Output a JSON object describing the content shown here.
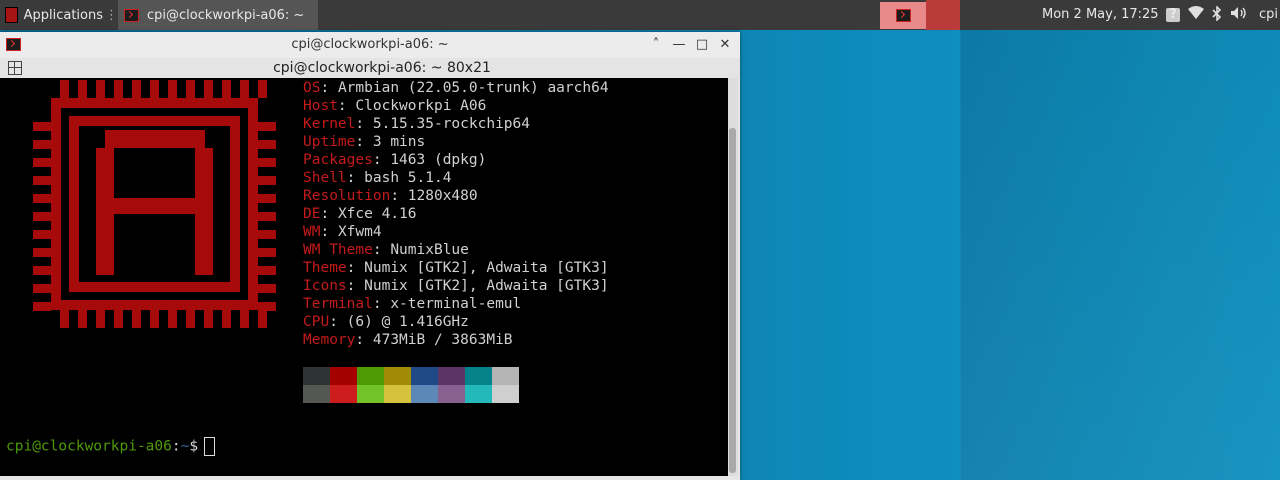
{
  "panel": {
    "applications_label": "Applications",
    "task_title": "cpi@clockworkpi-a06: ~",
    "clock": "Mon  2 May, 17:25",
    "user": "cpi"
  },
  "window": {
    "title": "cpi@clockworkpi-a06: ~",
    "tab_title": "cpi@clockworkpi-a06: ~ 80x21",
    "controls": {
      "up": "˄",
      "minimize": "—",
      "maximize": "□",
      "close": "✕"
    }
  },
  "sysinfo": [
    {
      "key": "OS",
      "value": "Armbian (22.05.0-trunk) aarch64"
    },
    {
      "key": "Host",
      "value": "Clockworkpi A06"
    },
    {
      "key": "Kernel",
      "value": "5.15.35-rockchip64"
    },
    {
      "key": "Uptime",
      "value": "3 mins"
    },
    {
      "key": "Packages",
      "value": "1463 (dpkg)"
    },
    {
      "key": "Shell",
      "value": "bash 5.1.4"
    },
    {
      "key": "Resolution",
      "value": "1280x480"
    },
    {
      "key": "DE",
      "value": "Xfce 4.16"
    },
    {
      "key": "WM",
      "value": "Xfwm4"
    },
    {
      "key": "WM Theme",
      "value": "NumixBlue"
    },
    {
      "key": "Theme",
      "value": "Numix [GTK2], Adwaita [GTK3]"
    },
    {
      "key": "Icons",
      "value": "Numix [GTK2], Adwaita [GTK3]"
    },
    {
      "key": "Terminal",
      "value": "x-terminal-emul"
    },
    {
      "key": "CPU",
      "value": "(6) @ 1.416GHz"
    },
    {
      "key": "Memory",
      "value": "473MiB / 3863MiB"
    }
  ],
  "palette": {
    "row1": [
      "#2e3436",
      "#a40000",
      "#4e9a06",
      "#a18a06",
      "#204a87",
      "#5c3566",
      "#06828a",
      "#b4b4b4"
    ],
    "row2": [
      "#555753",
      "#cc1c1c",
      "#73c22a",
      "#d6c23c",
      "#5c88b8",
      "#8a6090",
      "#24b8bb",
      "#cfcfcf"
    ]
  },
  "prompt": {
    "user_host": "cpi@clockworkpi-a06",
    "sep": ":",
    "path": "~",
    "symbol": "$"
  },
  "logo_color": "#a60a0a",
  "tray_icons": [
    "help-icon",
    "wifi-icon",
    "bluetooth-icon",
    "volume-icon"
  ]
}
